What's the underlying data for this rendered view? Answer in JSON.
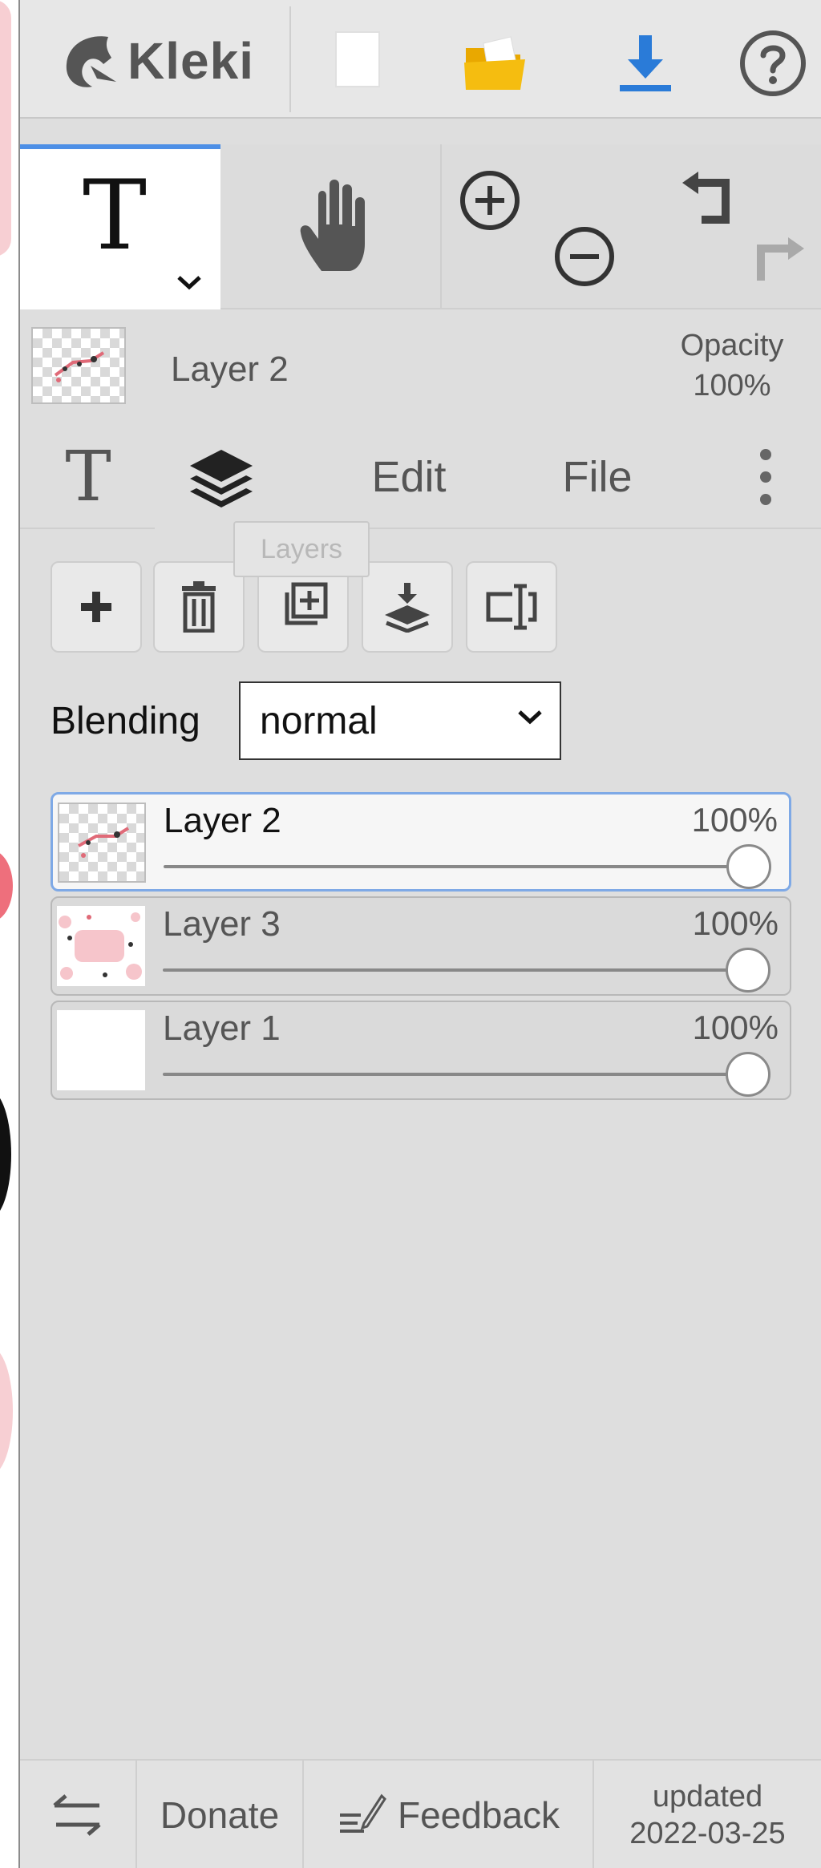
{
  "topbar": {
    "logo_text": "Kleki",
    "buttons": [
      {
        "name": "new-image",
        "icon": "blank-page-icon"
      },
      {
        "name": "open",
        "icon": "folder-icon"
      },
      {
        "name": "save",
        "icon": "download-icon"
      },
      {
        "name": "help",
        "icon": "question-icon"
      }
    ],
    "colors": {
      "folder": "#f5b800",
      "download": "#2a7bd8"
    }
  },
  "tools": {
    "active_tool_glyph": "T",
    "active_tool": "text",
    "hand": "hand-icon",
    "zoom_in": "zoom-in-icon",
    "zoom_out": "zoom-out-icon",
    "undo": "undo-icon",
    "redo": "redo-icon"
  },
  "layer_info": {
    "name": "Layer 2",
    "opacity_label": "Opacity",
    "opacity_value": "100%"
  },
  "tabs": {
    "text_glyph": "T",
    "layers_icon": "layers-icon",
    "edit": "Edit",
    "file": "File",
    "more_icon": "more-vertical-icon",
    "active": "layers"
  },
  "tooltip": "Layers",
  "layer_actions": [
    "add-layer-icon",
    "delete-layer-icon",
    "duplicate-layer-icon",
    "merge-down-icon",
    "rename-layer-icon"
  ],
  "blending": {
    "label": "Blending",
    "value": "normal"
  },
  "layers": [
    {
      "name": "Layer 2",
      "opacity": "100%",
      "opacity_fraction": 1.0,
      "selected": true
    },
    {
      "name": "Layer 3",
      "opacity": "100%",
      "opacity_fraction": 1.0,
      "selected": false
    },
    {
      "name": "Layer 1",
      "opacity": "100%",
      "opacity_fraction": 1.0,
      "selected": false
    }
  ],
  "footer": {
    "swap_icon": "swap-arrows-icon",
    "donate": "Donate",
    "feedback": "Feedback",
    "feedback_icon": "feedback-pen-icon",
    "updated_label": "updated",
    "updated_date": "2022-03-25"
  }
}
